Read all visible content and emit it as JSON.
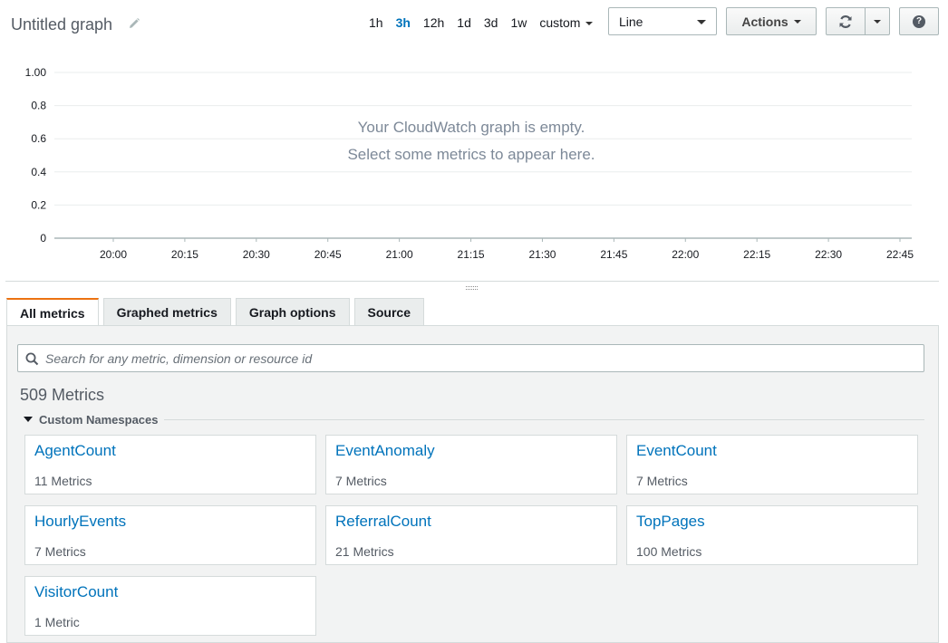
{
  "header": {
    "title": "Untitled graph",
    "time_ranges": [
      {
        "label": "1h",
        "active": false
      },
      {
        "label": "3h",
        "active": true
      },
      {
        "label": "12h",
        "active": false
      },
      {
        "label": "1d",
        "active": false
      },
      {
        "label": "3d",
        "active": false
      },
      {
        "label": "1w",
        "active": false
      }
    ],
    "custom_label": "custom",
    "chart_type_value": "Line",
    "actions_label": "Actions",
    "help_label": "?"
  },
  "chart": {
    "y_ticks": [
      "1.00",
      "0.8",
      "0.6",
      "0.4",
      "0.2",
      "0"
    ],
    "x_ticks": [
      "20:00",
      "20:15",
      "20:30",
      "20:45",
      "21:00",
      "21:15",
      "21:30",
      "21:45",
      "22:00",
      "22:15",
      "22:30",
      "22:45"
    ],
    "empty_line1": "Your CloudWatch graph is empty.",
    "empty_line2": "Select some metrics to appear here."
  },
  "tabs": [
    {
      "label": "All metrics",
      "active": true
    },
    {
      "label": "Graphed metrics",
      "active": false
    },
    {
      "label": "Graph options",
      "active": false
    },
    {
      "label": "Source",
      "active": false
    }
  ],
  "browser": {
    "search_placeholder": "Search for any metric, dimension or resource id",
    "metric_count": "509 Metrics",
    "namespace_group": "Custom Namespaces",
    "namespaces": [
      {
        "name": "AgentCount",
        "count": "11 Metrics"
      },
      {
        "name": "EventAnomaly",
        "count": "7 Metrics"
      },
      {
        "name": "EventCount",
        "count": "7 Metrics"
      },
      {
        "name": "HourlyEvents",
        "count": "7 Metrics"
      },
      {
        "name": "ReferralCount",
        "count": "21 Metrics"
      },
      {
        "name": "TopPages",
        "count": "100 Metrics"
      },
      {
        "name": "VisitorCount",
        "count": "1 Metric"
      }
    ]
  },
  "colors": {
    "link": "#0073bb",
    "active_tab_accent": "#ec7211",
    "muted_text": "#545b64"
  }
}
